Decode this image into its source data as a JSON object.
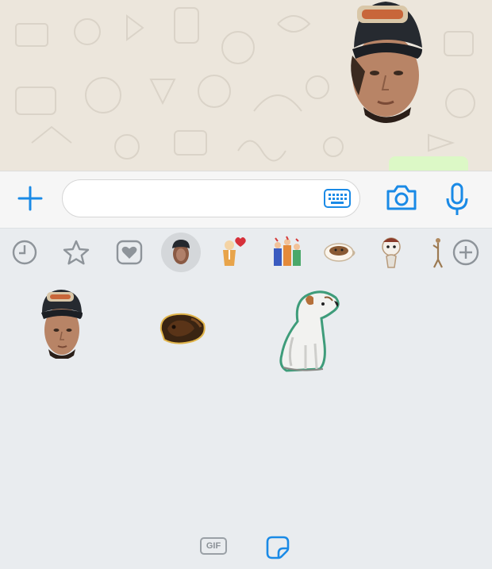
{
  "colors": {
    "accent": "#1a8ae6",
    "tray_background": "#e9ecef",
    "chat_background": "#ece6dc",
    "bubble_green": "#dcf8c6"
  },
  "input_bar": {
    "plus_icon": "plus-icon",
    "message_placeholder": "",
    "message_value": "",
    "keyboard_icon": "keyboard-icon",
    "camera_icon": "camera-icon",
    "mic_icon": "microphone-icon"
  },
  "sticker_tabs": [
    {
      "name": "recent",
      "icon": "clock-icon"
    },
    {
      "name": "favorites",
      "icon": "star-icon"
    },
    {
      "name": "heart",
      "icon": "heart-icon"
    },
    {
      "name": "custom-pack",
      "icon": "face-sticker-icon",
      "selected": true
    },
    {
      "name": "cuppy-love",
      "icon": "cup-heart-sticker-icon"
    },
    {
      "name": "party",
      "icon": "party-sticker-icon"
    },
    {
      "name": "coffee",
      "icon": "coffee-cup-sticker-icon"
    },
    {
      "name": "character",
      "icon": "character-sticker-icon"
    },
    {
      "name": "figure",
      "icon": "figure-sticker-icon"
    },
    {
      "name": "add",
      "icon": "add-circle-icon"
    }
  ],
  "stickers": [
    {
      "name": "face-cap-sticker"
    },
    {
      "name": "dog-curled-sticker"
    },
    {
      "name": "dog-sitting-sticker"
    }
  ],
  "bottom_bar": {
    "gif_label": "GIF",
    "sticker_icon": "sticker-icon"
  }
}
